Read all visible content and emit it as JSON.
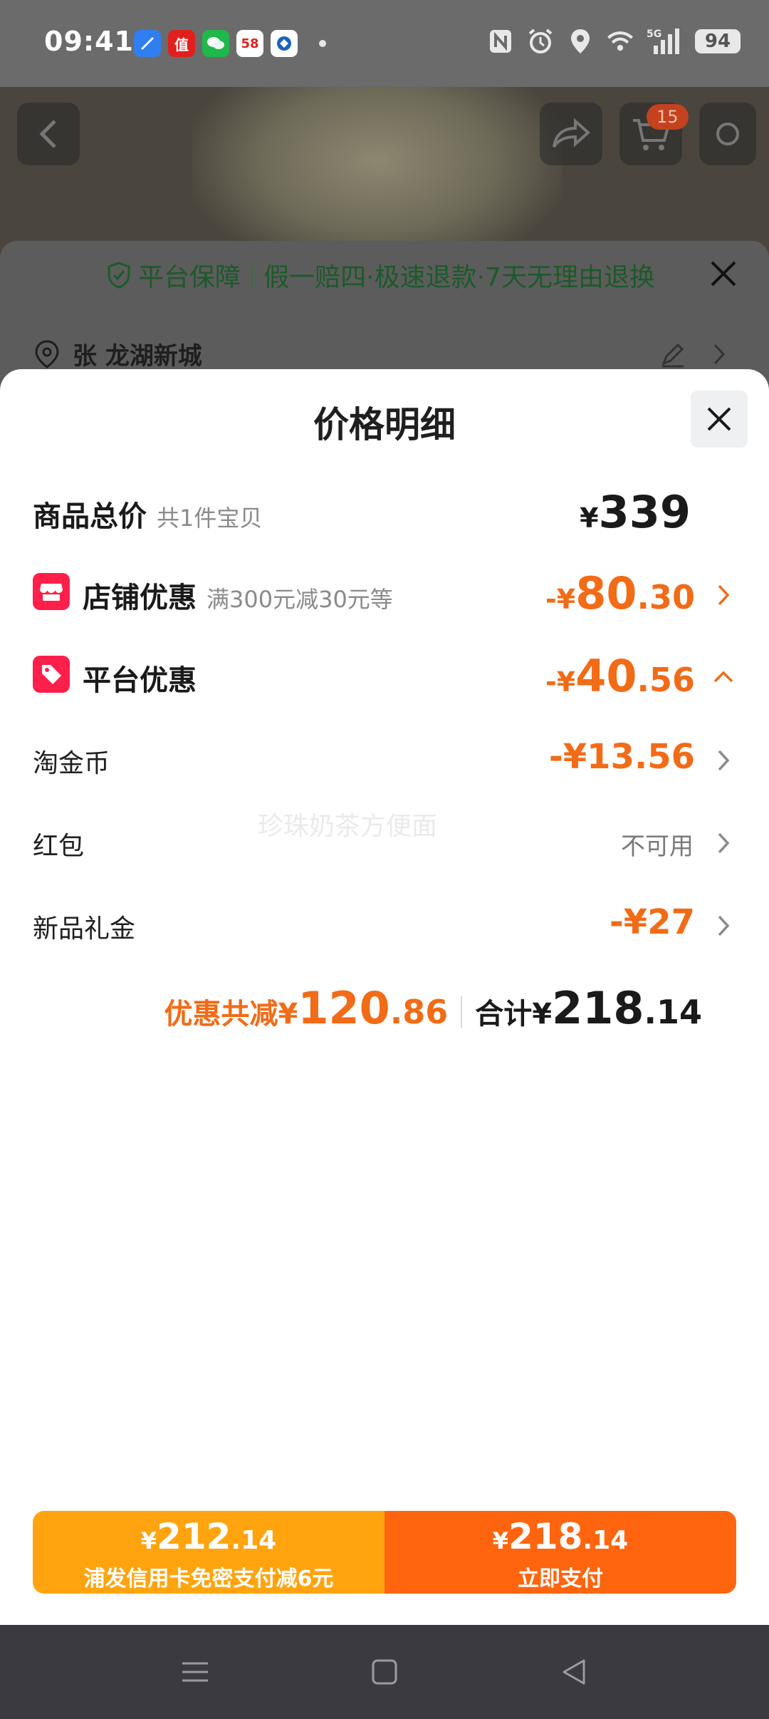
{
  "status_bar": {
    "time": "09:41",
    "battery": "94",
    "network": "5G",
    "app_icons": [
      "browser-icon",
      "smzdm-icon",
      "wechat-icon",
      "58-icon",
      "bank-icon"
    ],
    "app_icon_labels": [
      "",
      "值",
      "",
      "58",
      ""
    ]
  },
  "background": {
    "cart_count": "15",
    "guarantee_title": "平台保障",
    "guarantee_text": "假一赔四·极速退款·7天无理由退换",
    "address": "张 龙湖新城"
  },
  "sheet": {
    "title": "价格明细",
    "total": {
      "label": "商品总价",
      "sub": "共1件宝贝",
      "currency": "¥",
      "amount": "339"
    },
    "store_discount": {
      "label": "店铺优惠",
      "sub": "满300元减30元等",
      "prefix": "-¥",
      "int": "80",
      "dec": ".30"
    },
    "platform_discount": {
      "label": "平台优惠",
      "prefix": "-¥",
      "int": "40",
      "dec": ".56"
    },
    "items": [
      {
        "label": "淘金币",
        "value": "-¥13.56"
      },
      {
        "label": "红包",
        "value": "不可用"
      },
      {
        "label": "新品礼金",
        "value": "-¥27"
      }
    ],
    "watermark": "珍珠奶茶方便面",
    "summary": {
      "discount_label": "优惠共减¥",
      "discount_int": "120",
      "discount_dec": ".86",
      "total_label": "合计¥",
      "total_int": "218",
      "total_dec": ".14"
    }
  },
  "pay": {
    "left": {
      "currency": "¥",
      "int": "212",
      "dec": ".14",
      "label": "浦发信用卡免密支付减6元"
    },
    "right": {
      "currency": "¥",
      "int": "218",
      "dec": ".14",
      "label": "立即支付"
    }
  },
  "colors": {
    "accent_orange": "#f26b16",
    "pay_left": "#ffa40e",
    "pay_right": "#ff650f",
    "badge_red": "#ff1f4b"
  }
}
